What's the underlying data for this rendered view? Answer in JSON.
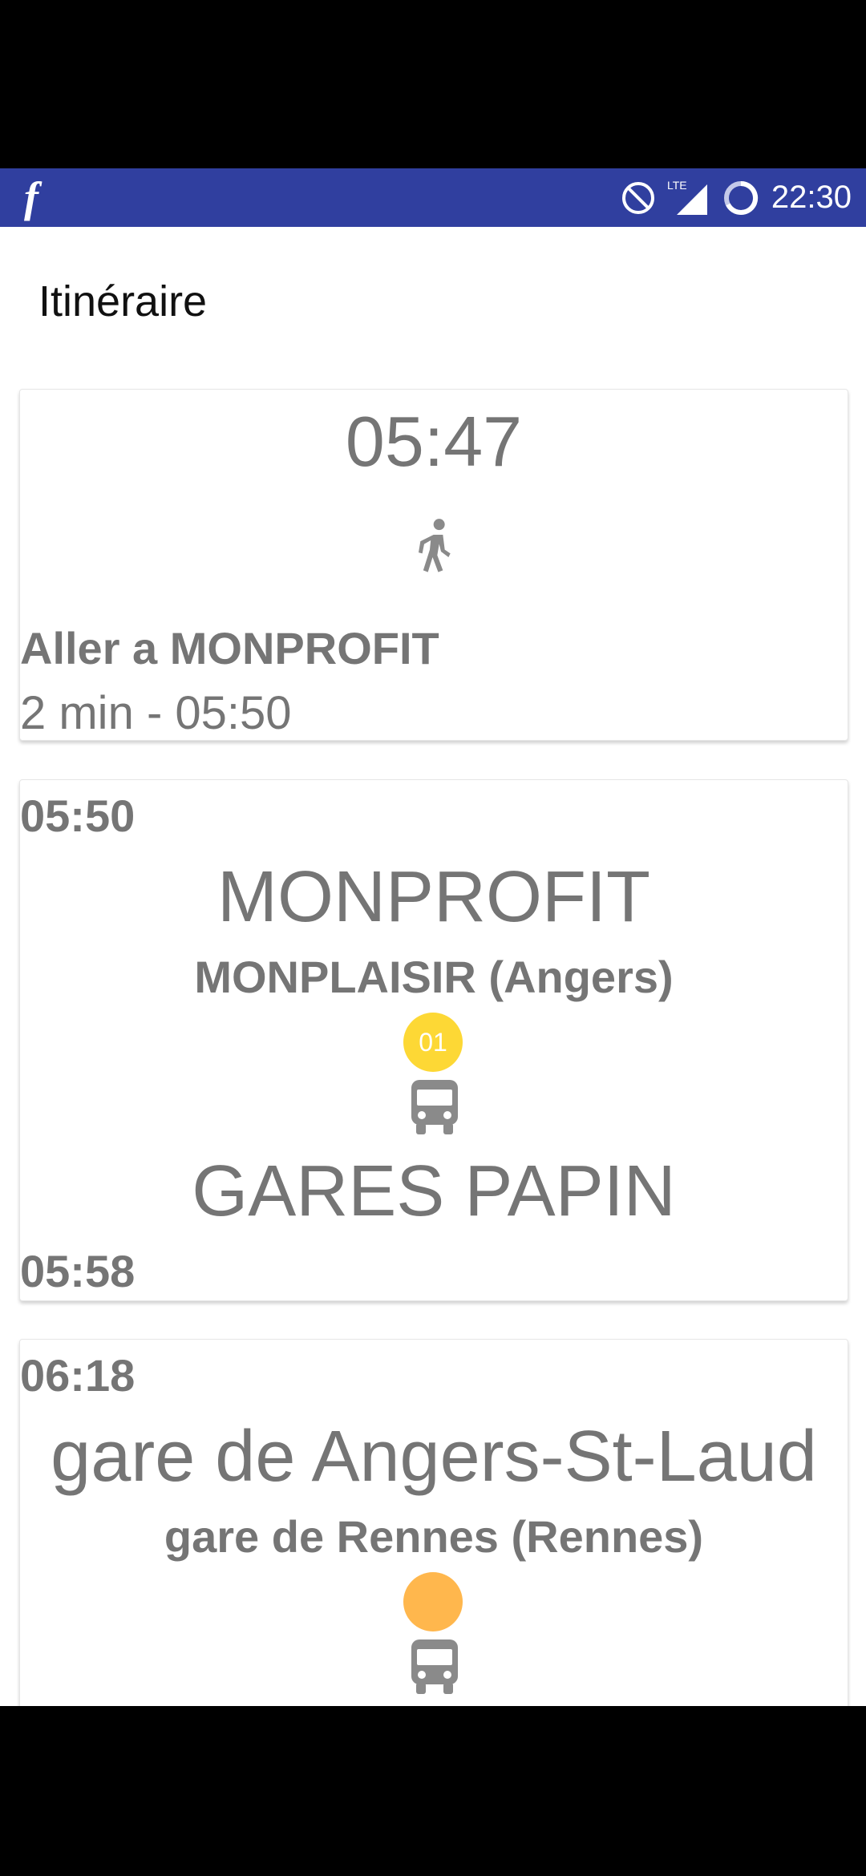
{
  "status_bar": {
    "app_icon": "f",
    "time": "22:30",
    "network": "LTE",
    "icons": [
      "do-not-disturb-icon",
      "lte-signal-icon",
      "sync-icon"
    ],
    "background_color": "#303f9f"
  },
  "page": {
    "title": "Itinéraire"
  },
  "steps": [
    {
      "type": "walk",
      "time": "05:47",
      "title": "Aller a MONPROFIT",
      "subtitle": "2 min - 05:50",
      "icon": "walk-icon"
    },
    {
      "type": "bus",
      "departure_time": "05:50",
      "from": "MONPROFIT",
      "direction": "MONPLAISIR (Angers)",
      "line": "01",
      "line_color": "#fdd835",
      "icon": "bus-icon",
      "to": "GARES PAPIN",
      "arrival_time": "05:58"
    },
    {
      "type": "bus",
      "departure_time": "06:18",
      "from": "gare de Angers-St-Laud",
      "direction": "gare de Rennes (Rennes)",
      "line": "",
      "line_color": "#ffb74d",
      "icon": "bus-icon"
    }
  ]
}
